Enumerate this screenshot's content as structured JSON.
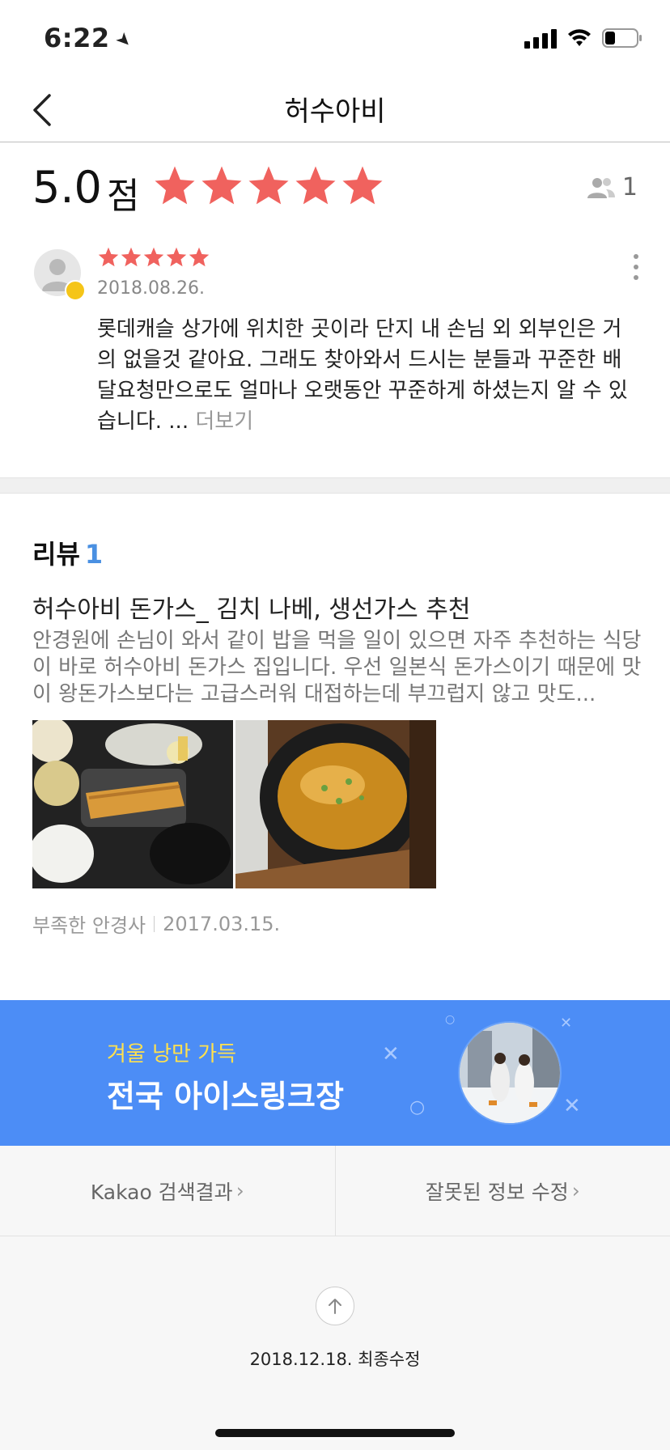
{
  "status_bar": {
    "time": "6:22"
  },
  "nav": {
    "title": "허수아비"
  },
  "rating": {
    "score": "5.0",
    "unit": "점",
    "stars": 5,
    "reviewer_count": "1",
    "star_color": "#f0625e"
  },
  "review": {
    "stars": 5,
    "date": "2018.08.26.",
    "text": "롯데캐슬 상가에 위치한 곳이라 단지 내 손님 외 외부인은 거의 없을것 같아요. 그래도 찾아와서 드시는 분들과 꾸준한 배달요청만으로도 얼마나 오랫동안 꾸준하게 하셨는지 알 수 있습니다. ...",
    "read_more": "더보기"
  },
  "blog": {
    "header": "리뷰",
    "count": "1",
    "title": "허수아비 돈가스_ 김치 나베, 생선가스 추천",
    "excerpt": "안경원에 손님이 와서 같이 밥을 먹을 일이 있으면 자주 추천하는 식당이 바로 허수아비 돈가스 집입니다. 우선 일본식 돈가스이기 때문에 맛이 왕돈가스보다는 고급스러워 대접하는데 부끄럽지 않고 맛도...",
    "author": "부족한 안경사",
    "date": "2017.03.15."
  },
  "banner": {
    "subtitle": "겨울 낭만 가득",
    "title": "전국 아이스링크장",
    "background": "#4c8df6"
  },
  "footer_links": {
    "kakao": "Kakao 검색결과",
    "report": "잘못된 정보 수정"
  },
  "footer": {
    "last_modified": "2018.12.18. 최종수정"
  }
}
